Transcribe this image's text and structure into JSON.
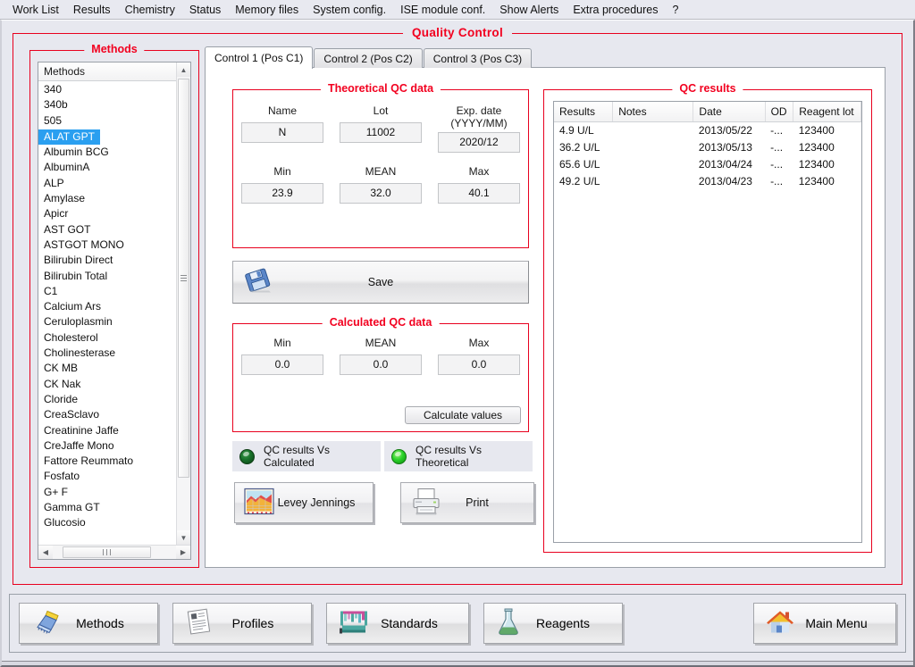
{
  "menu": {
    "items": [
      "Work List",
      "Results",
      "Chemistry",
      "Status",
      "Memory files",
      "System config.",
      "ISE module conf.",
      "Show Alerts",
      "Extra procedures",
      "?"
    ]
  },
  "window": {
    "title": "Quality Control"
  },
  "methods_panel": {
    "legend": "Methods",
    "column_header": "Methods",
    "selected": "ALAT GPT",
    "items": [
      "340",
      "340b",
      "505",
      "ALAT GPT",
      "Albumin BCG",
      "AlbuminA",
      "ALP",
      "Amylase",
      "Apicr",
      "AST GOT",
      "ASTGOT MONO",
      "Bilirubin Direct",
      "Bilirubin Total",
      "C1",
      "Calcium Ars",
      "Ceruloplasmin",
      "Cholesterol",
      "Cholinesterase",
      "CK MB",
      "CK Nak",
      "Cloride",
      "CreaSclavo",
      "Creatinine Jaffe",
      "CreJaffe Mono",
      "Fattore Reummato",
      "Fosfato",
      "G+ F",
      "Gamma GT",
      "Glucosio"
    ]
  },
  "tabs": [
    {
      "label": "Control 1 (Pos C1)",
      "active": true
    },
    {
      "label": "Control 2 (Pos C2)",
      "active": false
    },
    {
      "label": "Control 3 (Pos C3)",
      "active": false
    }
  ],
  "theoretical": {
    "legend": "Theoretical QC data",
    "labels": {
      "name": "Name",
      "lot": "Lot",
      "exp": "Exp. date",
      "exp2": "(YYYY/MM)",
      "min": "Min",
      "mean": "MEAN",
      "max": "Max"
    },
    "values": {
      "name": "N",
      "lot": "11002",
      "exp": "2020/12",
      "min": "23.9",
      "mean": "32.0",
      "max": "40.1"
    }
  },
  "save": {
    "label": "Save",
    "icon": "floppy-disk-icon"
  },
  "calculated": {
    "legend": "Calculated QC data",
    "labels": {
      "min": "Min",
      "mean": "MEAN",
      "max": "Max"
    },
    "values": {
      "min": "0.0",
      "mean": "0.0",
      "max": "0.0"
    },
    "calculate_button": "Calculate values"
  },
  "leds": [
    {
      "label": "QC results Vs Calculated",
      "state": "dim",
      "color": "#18702a"
    },
    {
      "label": "QC results Vs Theoretical",
      "state": "on",
      "color": "#2ad32a"
    }
  ],
  "panel_buttons": [
    {
      "label": "Levey Jennings",
      "icon": "area-chart-icon"
    },
    {
      "label": "Print",
      "icon": "printer-icon"
    }
  ],
  "qc_results": {
    "legend": "QC results",
    "columns": [
      "Results",
      "Notes",
      "Date",
      "OD",
      "Reagent lot"
    ],
    "rows": [
      {
        "results": "4.9 U/L",
        "notes": "",
        "date": "2013/05/22",
        "od": "-...",
        "lot": "123400"
      },
      {
        "results": "36.2 U/L",
        "notes": "",
        "date": "2013/05/13",
        "od": "-...",
        "lot": "123400"
      },
      {
        "results": "65.6 U/L",
        "notes": "",
        "date": "2013/04/24",
        "od": "-...",
        "lot": "123400"
      },
      {
        "results": "49.2 U/L",
        "notes": "",
        "date": "2013/04/23",
        "od": "-...",
        "lot": "123400"
      }
    ]
  },
  "toolbar": [
    {
      "label": "Methods",
      "icon": "methods-brush-icon"
    },
    {
      "label": "Profiles",
      "icon": "documents-icon"
    },
    {
      "label": "Standards",
      "icon": "standards-rack-icon"
    },
    {
      "label": "Reagents",
      "icon": "flask-icon"
    },
    {
      "label": "Main Menu",
      "icon": "home-icon"
    }
  ],
  "colors": {
    "group_border": "#e8001e",
    "group_title": "#f2001f",
    "selection": "#2a9ff0",
    "window_bg": "#e7e8ef"
  }
}
